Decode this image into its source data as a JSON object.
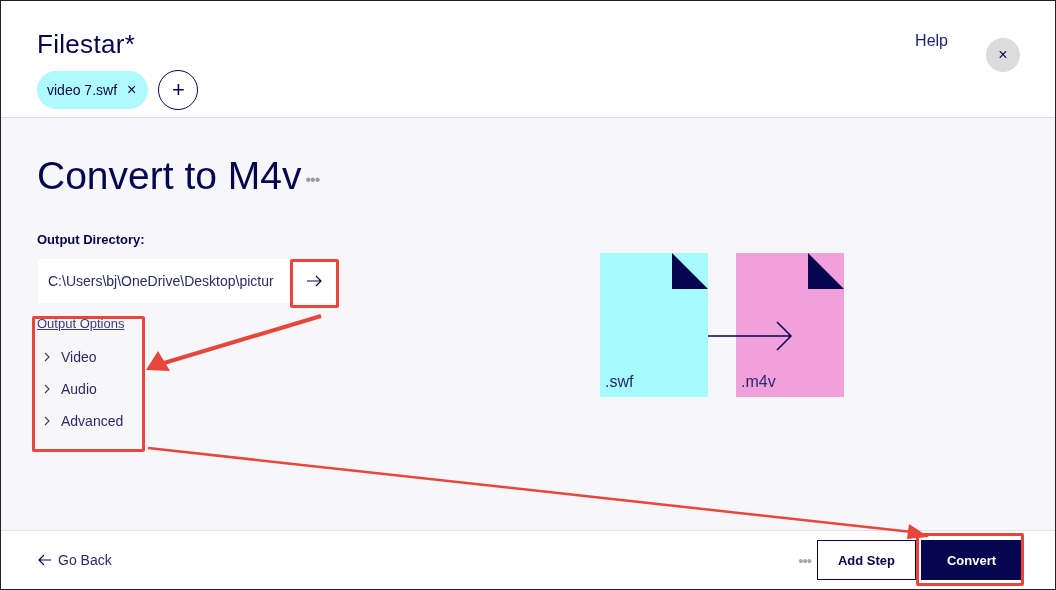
{
  "header": {
    "logo": "Filestar*",
    "help": "Help",
    "close": "×",
    "files": [
      {
        "name": "video 7.swf",
        "remove": "×"
      }
    ],
    "add": "+"
  },
  "main": {
    "title": "Convert to M4v",
    "more": "•••",
    "output_directory": {
      "label": "Output Directory:",
      "value": "C:\\Users\\bj\\OneDrive\\Desktop\\pictur"
    },
    "options_link": "Output Options",
    "options": [
      {
        "label": "Video",
        "expanded": false
      },
      {
        "label": "Audio",
        "expanded": false
      },
      {
        "label": "Advanced",
        "expanded": false
      }
    ],
    "conversion": [
      {
        "ext": ".swf",
        "color": "#a5fbfe"
      },
      {
        "ext": ".m4v",
        "color": "#f0a1dc"
      }
    ]
  },
  "footer": {
    "back": "Go Back",
    "more": "•••",
    "add_step": "Add Step",
    "convert": "Convert"
  }
}
